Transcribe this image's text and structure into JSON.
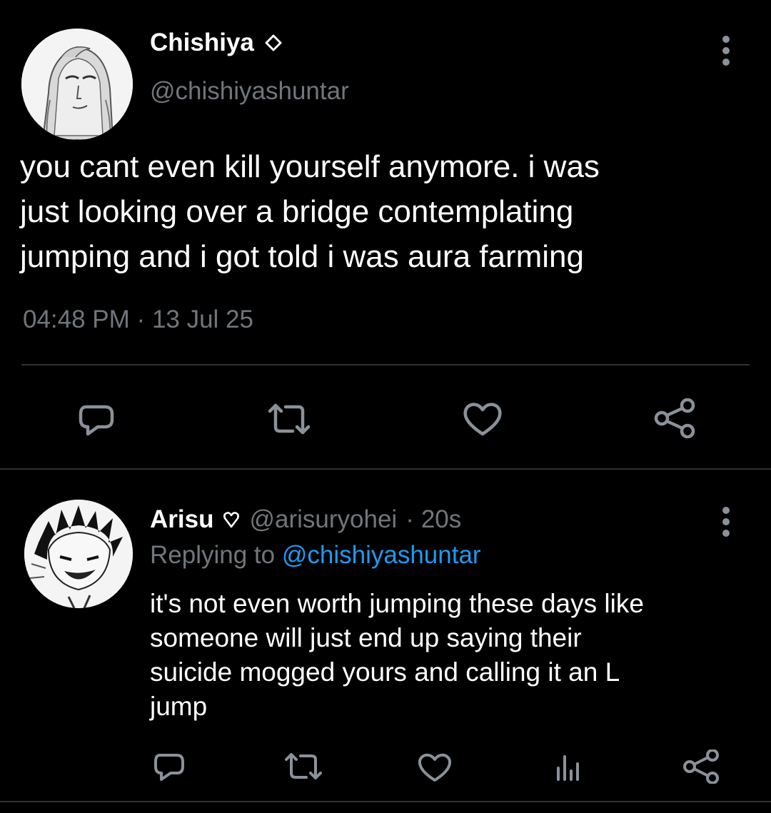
{
  "colors": {
    "background": "#000000",
    "text_primary": "#ffffff",
    "text_secondary": "#71767b",
    "link": "#1d9bf0",
    "divider": "#2f3336"
  },
  "main_tweet": {
    "author_name": "Chishiya",
    "badge_icon": "diamond-outline-icon",
    "author_handle": "@chishiyashuntar",
    "text": "you cant even kill yourself anymore. i was\njust looking over a bridge contemplating\njumping and i got told i was aura farming",
    "time": "04:48 PM",
    "separator": "·",
    "date": "13 Jul 25",
    "actions": [
      "reply-icon",
      "retweet-icon",
      "like-icon",
      "share-icon"
    ],
    "more_icon": "more-vertical-icon"
  },
  "reply": {
    "author_name": "Arisu",
    "badge_icon": "heart-outline-icon",
    "author_handle": "@arisuryohei",
    "separator": "·",
    "time": "20s",
    "replying_to_prefix": "Replying to",
    "replying_to_handle": "@chishiyashuntar",
    "text": "it's not even worth jumping these days like\nsomeone will just end up saying their\nsuicide mogged yours and calling it an L\njump",
    "actions": [
      "reply-icon",
      "retweet-icon",
      "like-icon",
      "views-icon",
      "share-icon"
    ],
    "more_icon": "more-vertical-icon"
  }
}
